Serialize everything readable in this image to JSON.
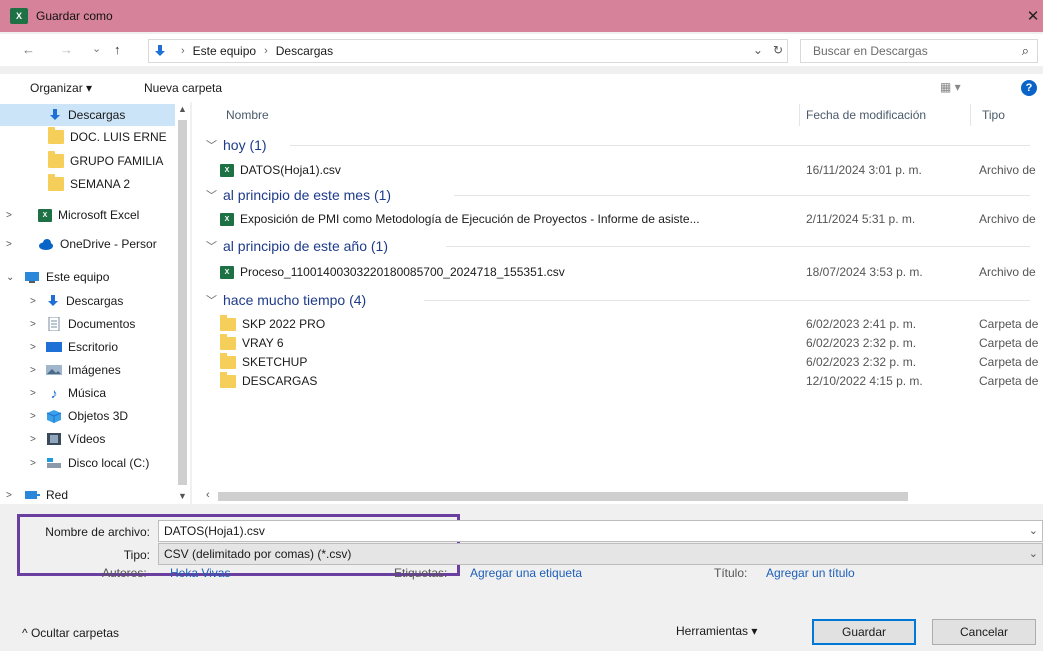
{
  "window": {
    "title": "Guardar como",
    "app_icon": "X",
    "close_glyph": "✕"
  },
  "nav": {
    "back": "←",
    "forward": "→",
    "recent": "⌄",
    "up": "↑",
    "breadcrumb": [
      "Este equipo",
      "Descargas"
    ],
    "addr_dropdown": "⌄",
    "refresh": "↻",
    "search_placeholder": "Buscar en Descargas",
    "search_icon": "⌕"
  },
  "toolbar": {
    "organize": "Organizar ▾",
    "new_folder": "Nueva carpeta",
    "view": "▦ ▾",
    "help": "?"
  },
  "sidebar": {
    "items": [
      {
        "label": "Descargas",
        "icon": "download-arrow",
        "selected": true,
        "chevron": "",
        "indent": 1
      },
      {
        "label": "DOC. LUIS ERNE",
        "icon": "folder",
        "chevron": "",
        "indent": 1
      },
      {
        "label": "GRUPO FAMILIA",
        "icon": "folder",
        "chevron": "",
        "indent": 1
      },
      {
        "label": "SEMANA 2",
        "icon": "folder",
        "chevron": "",
        "indent": 1
      },
      {
        "label": "Microsoft Excel",
        "icon": "excel",
        "chevron": ">",
        "indent": 0
      },
      {
        "label": "OneDrive - Persor",
        "icon": "cloud",
        "chevron": ">",
        "indent": 0
      },
      {
        "label": "Este equipo",
        "icon": "computer",
        "chevron": "⌄",
        "indent": 0
      },
      {
        "label": "Descargas",
        "icon": "download-arrow",
        "chevron": ">",
        "indent": 1
      },
      {
        "label": "Documentos",
        "icon": "document",
        "chevron": ">",
        "indent": 1
      },
      {
        "label": "Escritorio",
        "icon": "desktop",
        "chevron": ">",
        "indent": 1
      },
      {
        "label": "Imágenes",
        "icon": "images",
        "chevron": ">",
        "indent": 1
      },
      {
        "label": "Música",
        "icon": "music-note",
        "chevron": ">",
        "indent": 1
      },
      {
        "label": "Objetos 3D",
        "icon": "cube",
        "chevron": ">",
        "indent": 1
      },
      {
        "label": "Vídeos",
        "icon": "film",
        "chevron": ">",
        "indent": 1
      },
      {
        "label": "Disco local (C:)",
        "icon": "drive",
        "chevron": ">",
        "indent": 1
      },
      {
        "label": "Red",
        "icon": "network",
        "chevron": ">",
        "indent": 0
      }
    ]
  },
  "columns": {
    "name": "Nombre",
    "date": "Fecha de modificación",
    "type": "Tipo"
  },
  "groups": [
    {
      "label": "hoy (1)",
      "rows": [
        {
          "name": "DATOS(Hoja1).csv",
          "date": "16/11/2024 3:01 p. m.",
          "type": "Archivo de",
          "icon": "excel"
        }
      ]
    },
    {
      "label": "al principio de este mes (1)",
      "rows": [
        {
          "name": "Exposición de PMI como Metodología de Ejecución de Proyectos - Informe de asiste...",
          "date": "2/11/2024 5:31 p. m.",
          "type": "Archivo de",
          "icon": "excel"
        }
      ]
    },
    {
      "label": "al principio de este año (1)",
      "rows": [
        {
          "name": "Proceso_11001400303220180085700_2024718_155351.csv",
          "date": "18/07/2024 3:53 p. m.",
          "type": "Archivo de",
          "icon": "excel"
        }
      ]
    },
    {
      "label": "hace mucho tiempo (4)",
      "rows": [
        {
          "name": "SKP 2022 PRO",
          "date": "6/02/2023 2:41 p. m.",
          "type": "Carpeta de",
          "icon": "folder"
        },
        {
          "name": "VRAY 6",
          "date": "6/02/2023 2:32 p. m.",
          "type": "Carpeta de",
          "icon": "folder"
        },
        {
          "name": "SKETCHUP",
          "date": "6/02/2023 2:32 p. m.",
          "type": "Carpeta de",
          "icon": "folder"
        },
        {
          "name": "DESCARGAS",
          "date": "12/10/2022 4:15 p. m.",
          "type": "Carpeta de",
          "icon": "folder"
        }
      ]
    }
  ],
  "form": {
    "filename_label": "Nombre de archivo:",
    "filename_value": "DATOS(Hoja1).csv",
    "type_label": "Tipo:",
    "type_value": "CSV (delimitado por comas) (*.csv)",
    "authors_label": "Autores:",
    "authors_value": "Heka Vivas",
    "tags_label": "Etiquetas:",
    "tags_value": "Agregar una etiqueta",
    "title_label": "Título:",
    "title_value": "Agregar un título",
    "hide_folders": "^  Ocultar carpetas",
    "tools": "Herramientas   ▾",
    "save": "Guardar",
    "cancel": "Cancelar"
  },
  "colors": {
    "titlebar": "#d6829b",
    "highlight_box": "#6b3fa0",
    "link": "#1e5fb8",
    "group_header": "#1e3b8a",
    "selected_bg": "#cce4f7"
  }
}
